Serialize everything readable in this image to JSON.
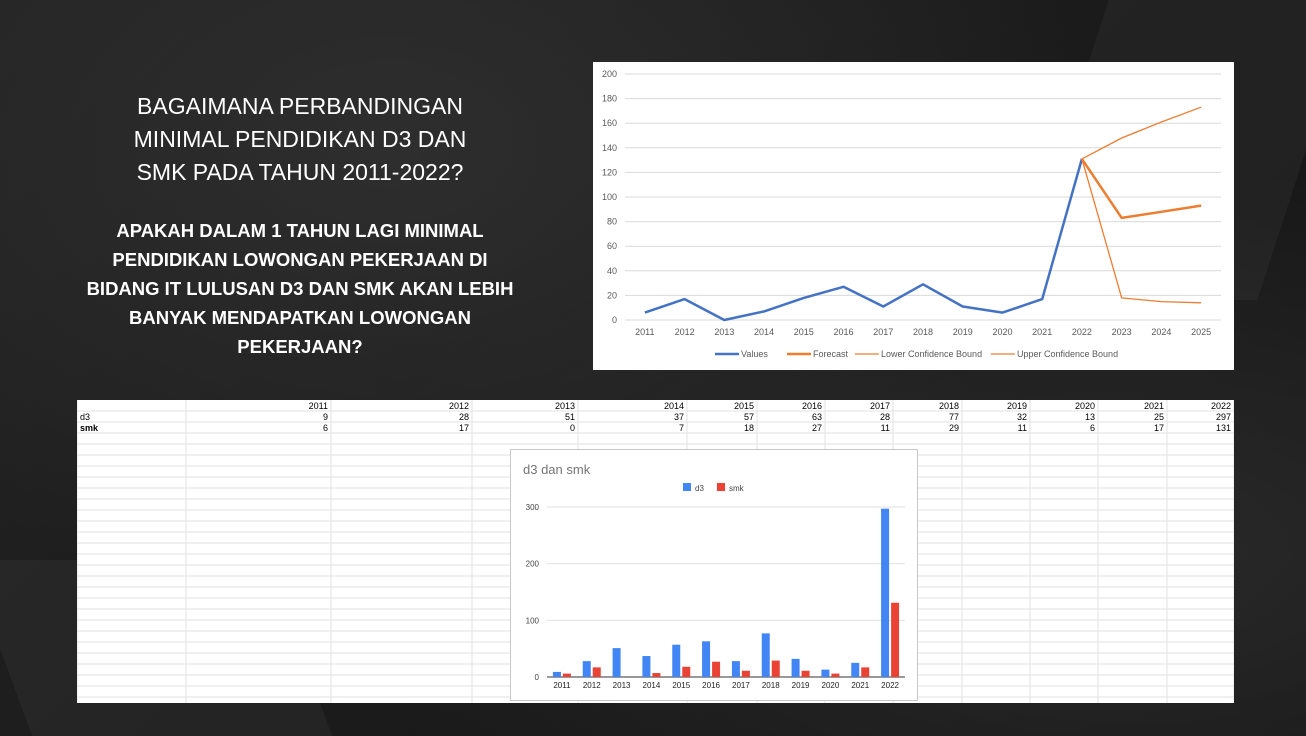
{
  "slide": {
    "question_1": "BAGAIMANA PERBANDINGAN\nMINIMAL PENDIDIKAN D3 DAN\nSMK PADA TAHUN 2011-2022?",
    "question_2": "APAKAH DALAM 1 TAHUN LAGI MINIMAL\nPENDIDIKAN LOWONGAN PEKERJAAN DI\nBIDANG IT LULUSAN D3 DAN SMK AKAN LEBIH\nBANYAK MENDAPATKAN LOWONGAN\nPEKERJAAN?"
  },
  "spreadsheet": {
    "headers": [
      "",
      "2011",
      "2012",
      "2013",
      "2014",
      "2015",
      "2016",
      "2017",
      "2018",
      "2019",
      "2020",
      "2021",
      "2022"
    ],
    "rows": [
      {
        "label": "d3",
        "values": [
          "9",
          "28",
          "51",
          "37",
          "57",
          "63",
          "28",
          "77",
          "32",
          "13",
          "25",
          "297"
        ]
      },
      {
        "label": "smk",
        "values": [
          "6",
          "17",
          "0",
          "7",
          "18",
          "27",
          "11",
          "29",
          "11",
          "6",
          "17",
          "131"
        ]
      }
    ]
  },
  "chart_data": [
    {
      "type": "line",
      "title": "",
      "xlabel": "",
      "ylabel": "",
      "x": [
        "2011",
        "2012",
        "2013",
        "2014",
        "2015",
        "2016",
        "2017",
        "2018",
        "2019",
        "2020",
        "2021",
        "2022",
        "2023",
        "2024",
        "2025"
      ],
      "ylim": [
        0,
        200
      ],
      "yticks": [
        "0",
        "20",
        "40",
        "60",
        "80",
        "100",
        "120",
        "140",
        "160",
        "180",
        "200"
      ],
      "grid": true,
      "legend_position": "bottom",
      "series": [
        {
          "name": "Values",
          "color": "#4472c4",
          "values": [
            6,
            17,
            0,
            7,
            18,
            27,
            11,
            29,
            11,
            6,
            17,
            131,
            null,
            null,
            null
          ]
        },
        {
          "name": "Forecast",
          "color": "#ed7d31",
          "values": [
            null,
            null,
            null,
            null,
            null,
            null,
            null,
            null,
            null,
            null,
            null,
            131,
            83,
            88,
            93
          ]
        },
        {
          "name": "Lower Confidence Bound",
          "color": "#ed7d31",
          "values": [
            null,
            null,
            null,
            null,
            null,
            null,
            null,
            null,
            null,
            null,
            null,
            131,
            18,
            15,
            14
          ]
        },
        {
          "name": "Upper Confidence Bound",
          "color": "#ed7d31",
          "values": [
            null,
            null,
            null,
            null,
            null,
            null,
            null,
            null,
            null,
            null,
            null,
            131,
            148,
            161,
            173
          ]
        }
      ]
    },
    {
      "type": "bar",
      "title": "d3 dan smk",
      "xlabel": "",
      "ylabel": "",
      "categories": [
        "2011",
        "2012",
        "2013",
        "2014",
        "2015",
        "2016",
        "2017",
        "2018",
        "2019",
        "2020",
        "2021",
        "2022"
      ],
      "ylim": [
        0,
        300
      ],
      "yticks": [
        "0",
        "100",
        "200",
        "300"
      ],
      "grid": true,
      "legend_position": "top",
      "series": [
        {
          "name": "d3",
          "color": "#4285f4",
          "values": [
            9,
            28,
            51,
            37,
            57,
            63,
            28,
            77,
            32,
            13,
            25,
            297
          ]
        },
        {
          "name": "smk",
          "color": "#ea4335",
          "values": [
            6,
            17,
            0,
            7,
            18,
            27,
            11,
            29,
            11,
            6,
            17,
            131
          ]
        }
      ]
    }
  ]
}
